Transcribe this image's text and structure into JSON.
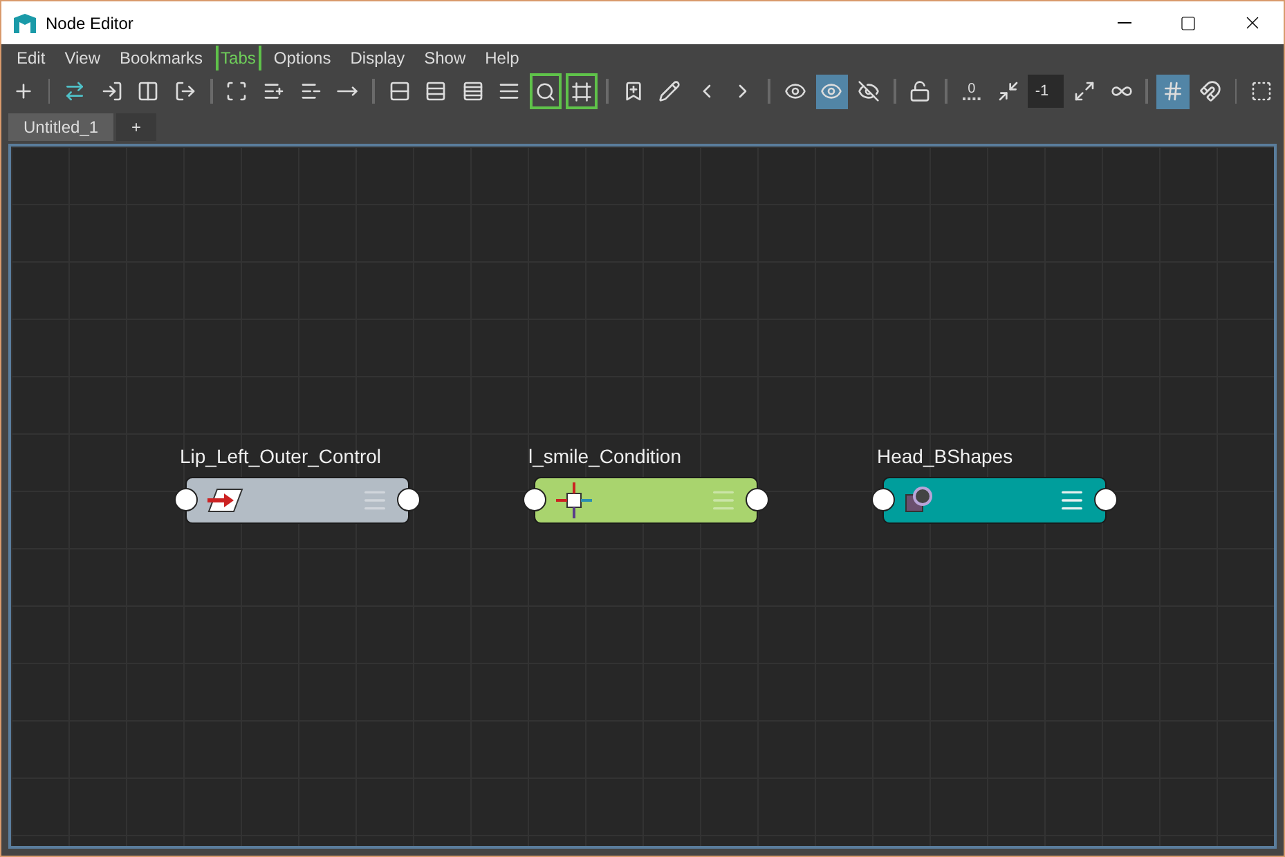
{
  "window": {
    "title": "Node Editor"
  },
  "menu": [
    {
      "label": "Edit",
      "highlighted": false
    },
    {
      "label": "View",
      "highlighted": false
    },
    {
      "label": "Bookmarks",
      "highlighted": false
    },
    {
      "label": "Tabs",
      "highlighted": true
    },
    {
      "label": "Options",
      "highlighted": false
    },
    {
      "label": "Display",
      "highlighted": false
    },
    {
      "label": "Show",
      "highlighted": false
    },
    {
      "label": "Help",
      "highlighted": false
    }
  ],
  "toolbar": [
    {
      "kind": "button",
      "on": false
    },
    {
      "kind": "separator"
    },
    {
      "kind": "button",
      "on": false
    },
    {
      "kind": "button",
      "on": false
    },
    {
      "kind": "button",
      "on": false
    },
    {
      "kind": "button",
      "on": false
    },
    {
      "kind": "separator"
    },
    {
      "kind": "button",
      "on": false
    },
    {
      "kind": "button",
      "on": false
    },
    {
      "kind": "button",
      "on": false
    },
    {
      "kind": "button",
      "on": false
    },
    {
      "kind": "separator"
    },
    {
      "kind": "button",
      "on": false
    },
    {
      "kind": "button",
      "on": false
    },
    {
      "kind": "button",
      "on": false
    },
    {
      "kind": "button",
      "on": false
    },
    {
      "kind": "bracket"
    },
    {
      "kind": "bracket"
    },
    {
      "kind": "separator"
    },
    {
      "kind": "button",
      "on": false
    },
    {
      "kind": "button",
      "on": false
    },
    {
      "kind": "button",
      "on": false
    },
    {
      "kind": "button",
      "on": false
    },
    {
      "kind": "separator"
    },
    {
      "kind": "button",
      "on": false
    },
    {
      "kind": "button",
      "on": true
    },
    {
      "kind": "button",
      "on": false
    },
    {
      "kind": "separator"
    },
    {
      "kind": "button",
      "on": false
    },
    {
      "kind": "separator"
    },
    {
      "kind": "label",
      "label": "0"
    },
    {
      "kind": "button",
      "on": false
    },
    {
      "kind": "field",
      "value": "-1"
    },
    {
      "kind": "button",
      "on": false
    },
    {
      "kind": "button",
      "on": false
    },
    {
      "kind": "separator"
    },
    {
      "kind": "button",
      "on": true
    },
    {
      "kind": "button",
      "on": false
    },
    {
      "kind": "separator"
    },
    {
      "kind": "button",
      "on": false
    }
  ],
  "tabs": [
    {
      "label": "Untitled_1",
      "selected": true
    },
    {
      "label": "+",
      "selected": false
    }
  ],
  "nodes": [
    {
      "name": "Lip_Left_Outer_Control",
      "color": "#b3bcc5"
    },
    {
      "name": "l_smile_Condition",
      "color": "#a9d46e"
    },
    {
      "name": "Head_BShapes",
      "color": "#009e9c"
    }
  ]
}
